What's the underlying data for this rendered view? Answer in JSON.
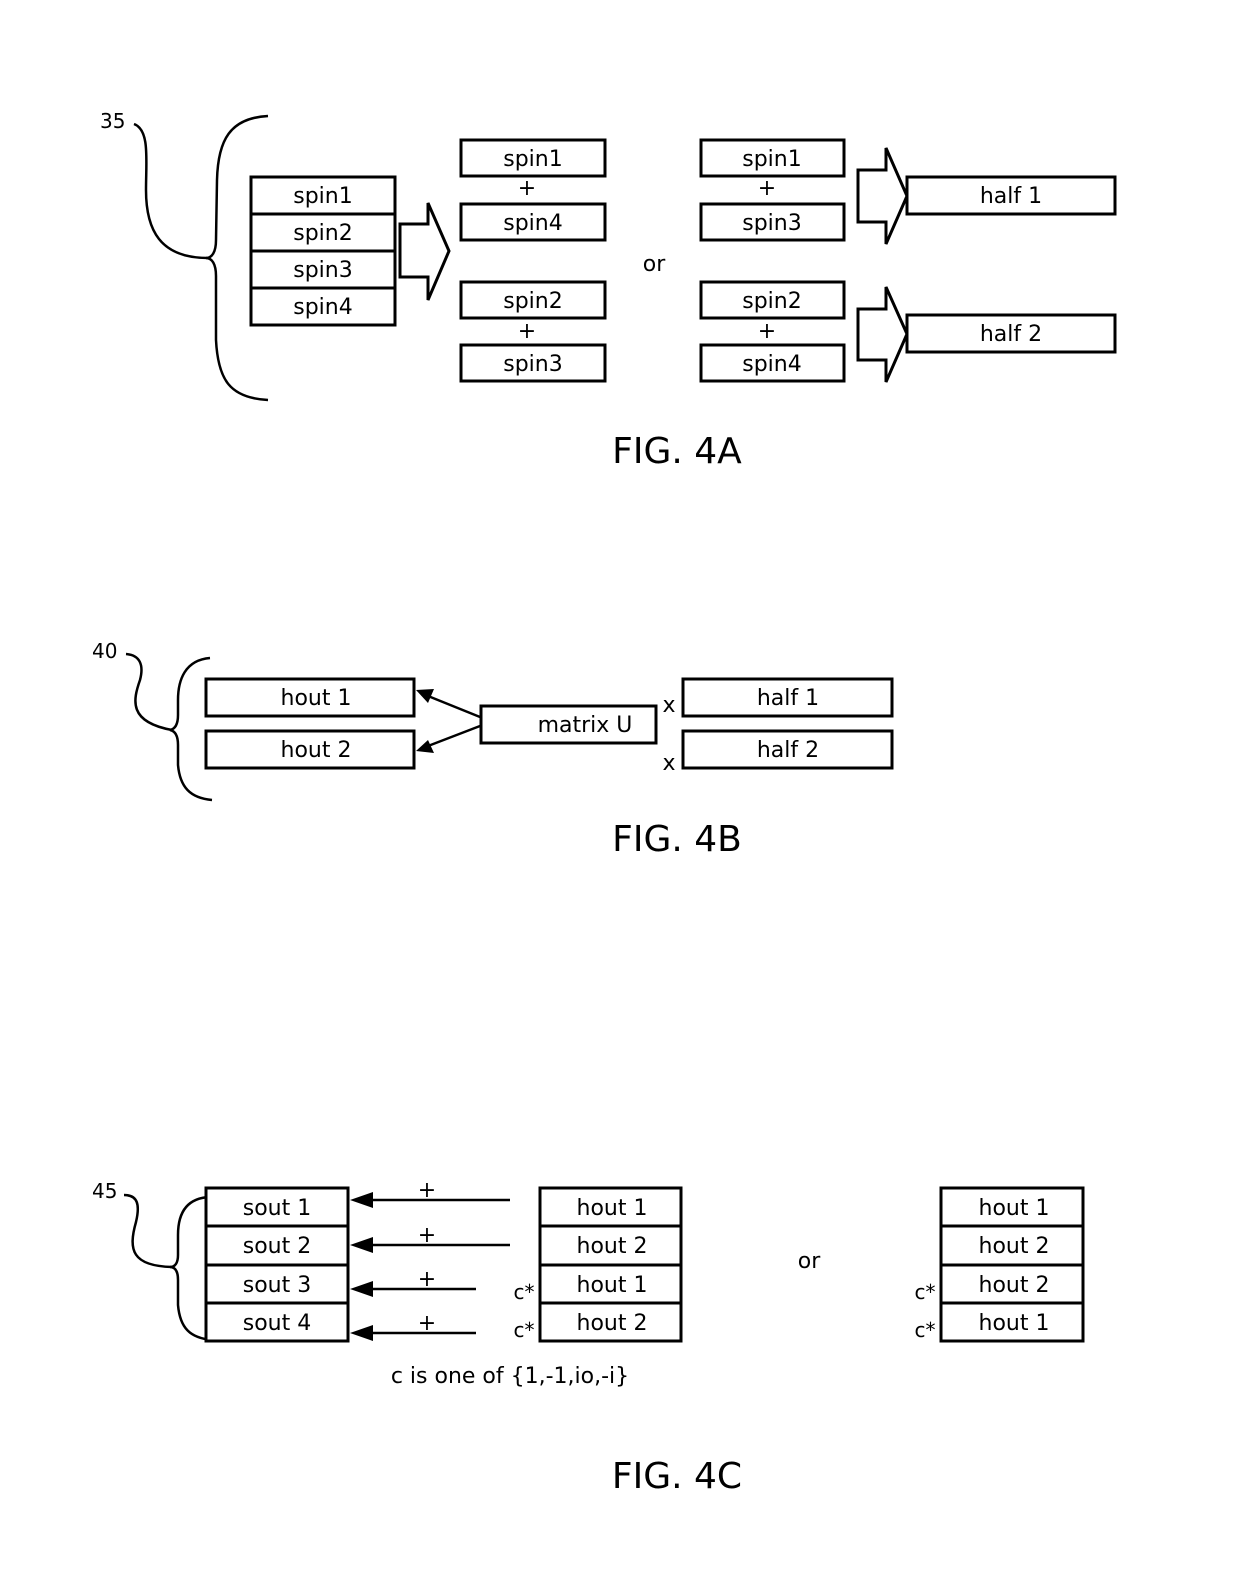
{
  "fig4a": {
    "ref_label": "35",
    "input_stack": [
      "spin1",
      "spin2",
      "spin3",
      "spin4"
    ],
    "option1": {
      "pair1": {
        "top": "spin1",
        "op": "+",
        "bottom": "spin4"
      },
      "pair2": {
        "top": "spin2",
        "op": "+",
        "bottom": "spin3"
      }
    },
    "or_label": "or",
    "option2": {
      "pair1": {
        "top": "spin1",
        "op": "+",
        "bottom": "spin3"
      },
      "pair2": {
        "top": "spin2",
        "op": "+",
        "bottom": "spin4"
      }
    },
    "outputs": [
      "half 1",
      "half 2"
    ],
    "caption": "FIG. 4A"
  },
  "fig4b": {
    "ref_label": "40",
    "outputs": [
      "hout 1",
      "hout 2"
    ],
    "matrix_label": "matrix U",
    "multiply_symbol": "x",
    "inputs": [
      "half 1",
      "half 2"
    ],
    "caption": "FIG. 4B"
  },
  "fig4c": {
    "ref_label": "45",
    "sout_stack": [
      "sout 1",
      "sout 2",
      "sout 3",
      "sout 4"
    ],
    "plus_symbol": "+",
    "hout_stack_left": [
      "hout 1",
      "hout 2",
      "hout 1",
      "hout 2"
    ],
    "coef_label": "c*",
    "or_label": "or",
    "hout_stack_right": [
      "hout 1",
      "hout 2",
      "hout 2",
      "hout 1"
    ],
    "note": "c is one of {1,-1,io,-i}",
    "caption": "FIG. 4C"
  }
}
